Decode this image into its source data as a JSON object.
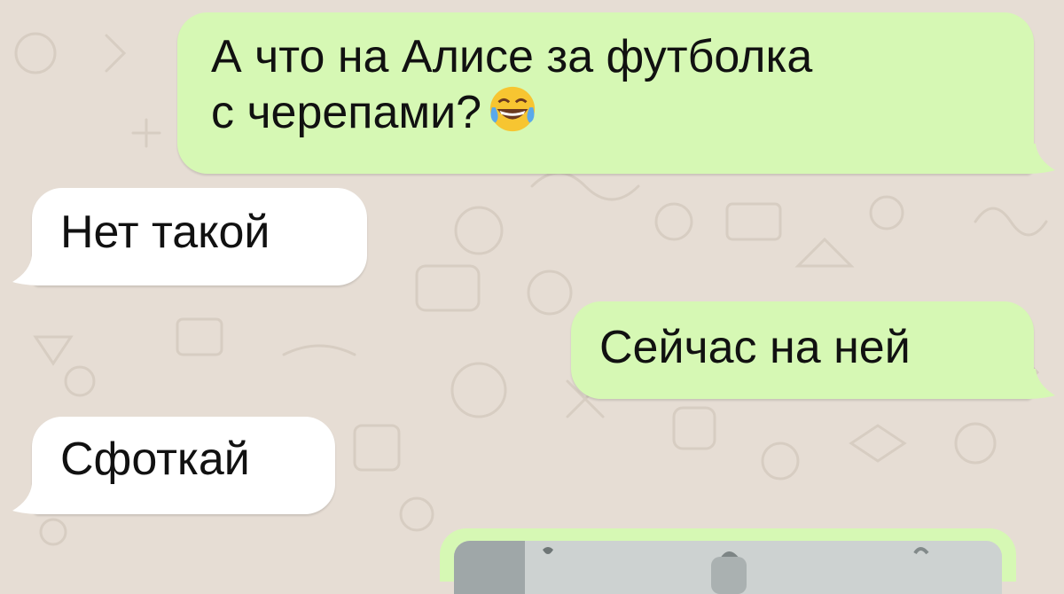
{
  "messages": [
    {
      "id": "m1",
      "direction": "outgoing",
      "lines": [
        "А что на Алисе за футболка",
        "с черепами?"
      ],
      "emoji": "face-with-tears-of-joy"
    },
    {
      "id": "m2",
      "direction": "incoming",
      "text": "Нет такой"
    },
    {
      "id": "m3",
      "direction": "outgoing",
      "text": "Сейчас на ней"
    },
    {
      "id": "m4",
      "direction": "incoming",
      "text": "Сфоткай"
    },
    {
      "id": "m5",
      "direction": "outgoing",
      "type": "photo"
    }
  ],
  "colors": {
    "outgoing_bubble": "#d6f8b4",
    "incoming_bubble": "#ffffff",
    "wallpaper": "#e6ddd4"
  }
}
